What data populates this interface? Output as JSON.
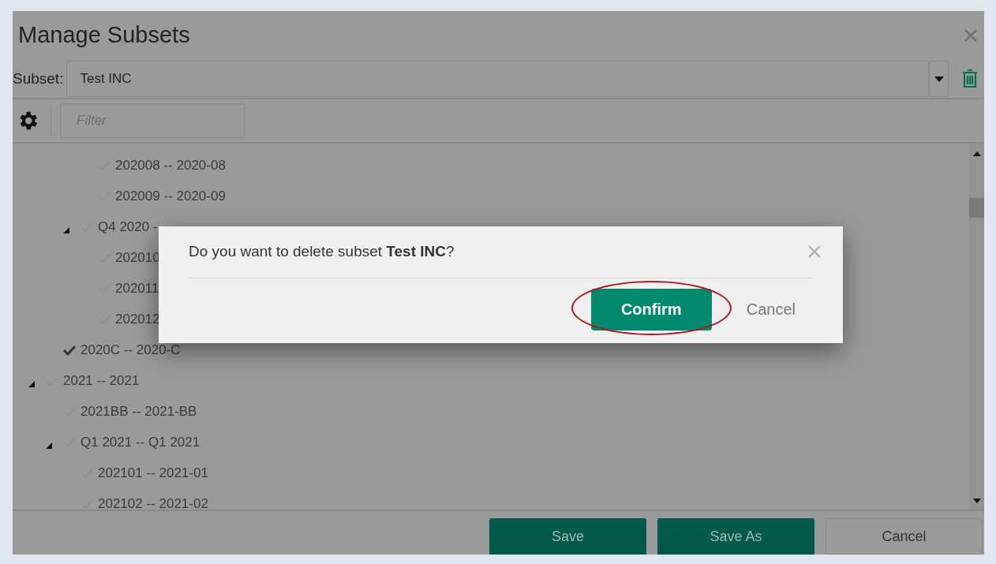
{
  "window": {
    "title": "Manage Subsets"
  },
  "subset": {
    "label": "Subset:",
    "value": "Test INC"
  },
  "filter": {
    "placeholder": "Filter"
  },
  "tree": [
    {
      "children": [
        {
          "children": [
            {
              "children": [
                {
                  "label": "202008 -- 2020-08",
                  "checked": false
                },
                {
                  "label": "202009 -- 2020-09",
                  "checked": false
                }
              ]
            },
            {
              "label": "Q4 2020 -",
              "checked": false,
              "expanded": true,
              "children": [
                {
                  "label": "202010",
                  "checked": false
                },
                {
                  "label": "202011",
                  "checked": false
                },
                {
                  "label": "202012",
                  "checked": false
                }
              ]
            }
          ]
        },
        {
          "label": "2020C -- 2020-C",
          "checked": true
        }
      ]
    },
    {
      "label": "2021 -- 2021",
      "checked": false,
      "expanded": true,
      "children": [
        {
          "label": "2021BB -- 2021-BB",
          "checked": false
        },
        {
          "label": "Q1 2021 -- Q1 2021",
          "checked": false,
          "expanded": true,
          "children": [
            {
              "label": "202101 -- 2021-01",
              "checked": false
            },
            {
              "label": "202102 -- 2021-02",
              "checked": false
            }
          ]
        }
      ]
    }
  ],
  "footer_buttons": [
    {
      "label": "Save",
      "kind": "primary"
    },
    {
      "label": "Save As",
      "kind": "primary"
    },
    {
      "label": "Cancel",
      "kind": "secondary"
    }
  ],
  "dialog": {
    "message": "Do you want to delete subset **Test INC**?",
    "confirm": {
      "label": "Confirm",
      "highlighted": true
    },
    "cancel": "Cancel"
  }
}
